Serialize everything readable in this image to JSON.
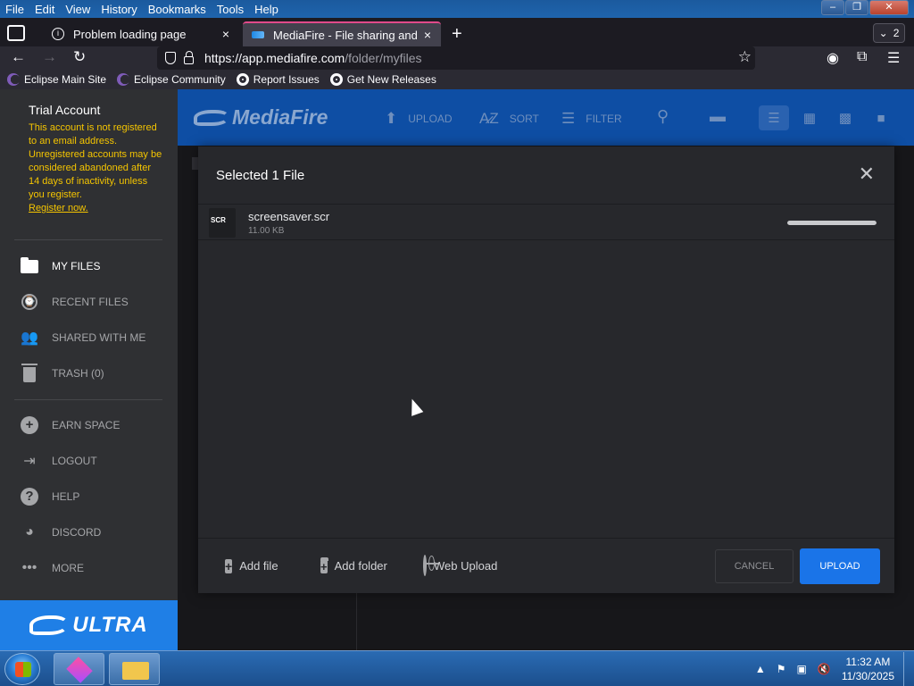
{
  "browser": {
    "menu": [
      "File",
      "Edit",
      "View",
      "History",
      "Bookmarks",
      "Tools",
      "Help"
    ],
    "tabs": [
      {
        "label": "Problem loading page",
        "close": "×"
      },
      {
        "label": "MediaFire - File sharing and storage",
        "close": "×"
      }
    ],
    "tab_count": "2",
    "url_host": "https://app.mediafire.com",
    "url_path": "/folder/myfiles",
    "bookmarks": [
      "Eclipse Main Site",
      "Eclipse Community",
      "Report Issues",
      "Get New Releases"
    ]
  },
  "sidebar": {
    "account_title": "Trial Account",
    "account_message": "This account is not registered to an email address. Unregistered accounts may be considered abandoned after 14 days of inactivity, unless you register.",
    "register_link": "Register now.",
    "nav": [
      {
        "label": "MY FILES",
        "icon": "folder-icon"
      },
      {
        "label": "RECENT FILES",
        "icon": "clock-icon"
      },
      {
        "label": "SHARED WITH ME",
        "icon": "people-icon"
      },
      {
        "label": "TRASH (0)",
        "icon": "trash-icon"
      }
    ],
    "extra": [
      {
        "label": "EARN SPACE",
        "icon": "plus-circle-icon"
      },
      {
        "label": "LOGOUT",
        "icon": "logout-icon"
      },
      {
        "label": "HELP",
        "icon": "help-icon"
      },
      {
        "label": "DISCORD",
        "icon": "discord-icon"
      },
      {
        "label": "MORE",
        "icon": "more-icon"
      }
    ],
    "ultra_label": "ULTRA"
  },
  "topbar": {
    "logo": "MediaFire",
    "upload": "UPLOAD",
    "sort": "SORT",
    "filter": "FILTER"
  },
  "modal": {
    "title": "Selected 1 File",
    "file": {
      "name": "screensaver.scr",
      "size": "11.00 KB",
      "badge": "SCR",
      "progress": 1.0
    },
    "add_file": "Add file",
    "add_folder": "Add folder",
    "web_upload": "Web Upload",
    "cancel": "CANCEL",
    "upload": "UPLOAD"
  },
  "taskbar": {
    "time": "11:32 AM",
    "date": "11/30/2025"
  },
  "colors": {
    "accent": "#1a74e8",
    "topbar": "#0e4ea4",
    "warning_text": "#f5c500"
  }
}
